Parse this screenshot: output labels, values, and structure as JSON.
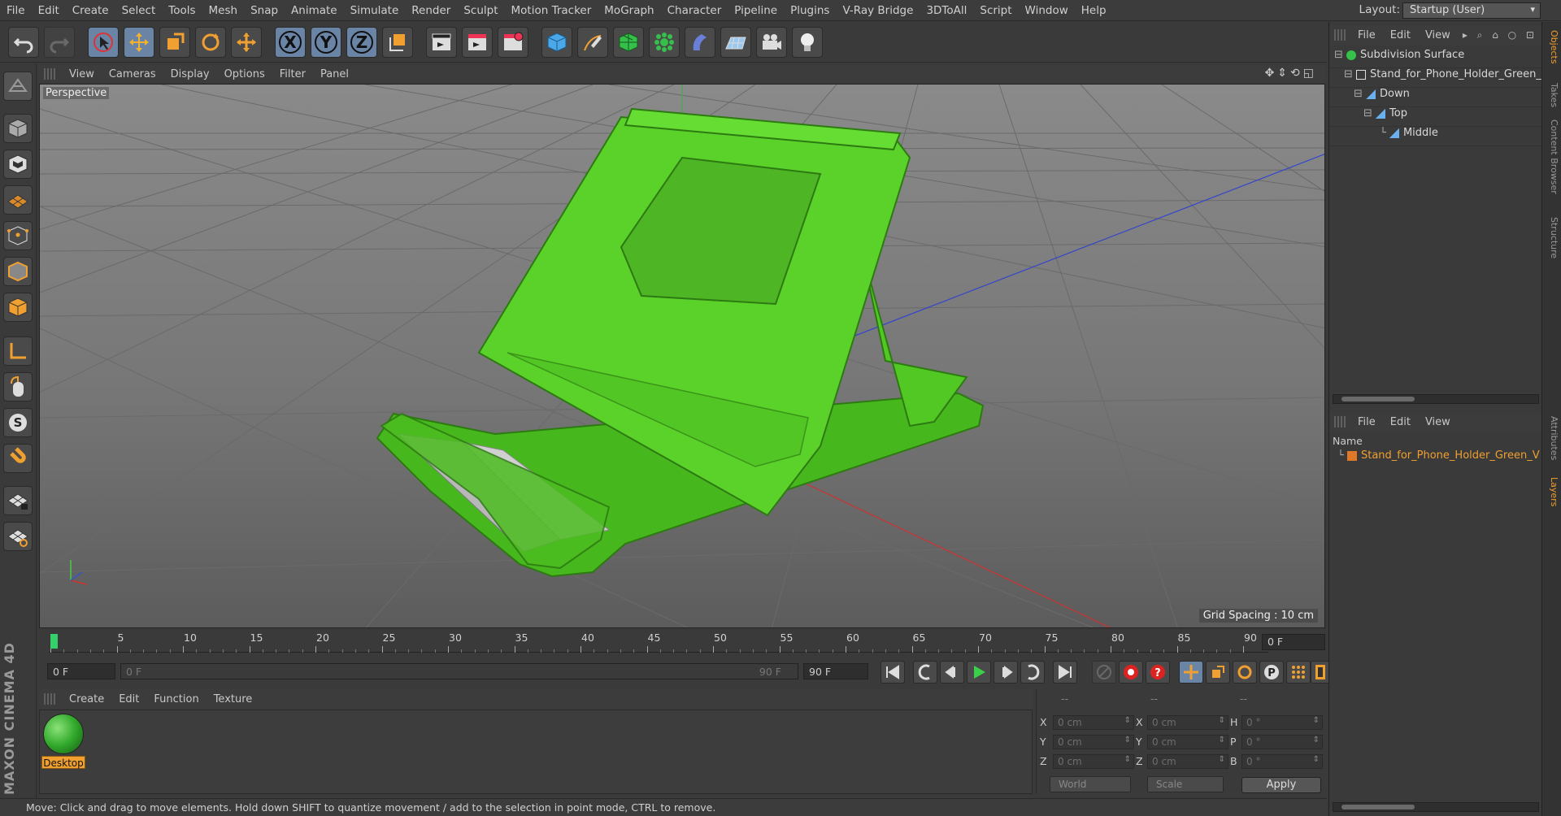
{
  "menu": [
    "File",
    "Edit",
    "Create",
    "Select",
    "Tools",
    "Mesh",
    "Snap",
    "Animate",
    "Simulate",
    "Render",
    "Sculpt",
    "Motion Tracker",
    "MoGraph",
    "Character",
    "Pipeline",
    "Plugins",
    "V-Ray Bridge",
    "3DToAll",
    "Script",
    "Window",
    "Help"
  ],
  "layout": {
    "label": "Layout:",
    "value": "Startup (User)"
  },
  "toolbar": {
    "x_label": "X",
    "y_label": "Y",
    "z_label": "Z"
  },
  "viewport": {
    "menu": [
      "View",
      "Cameras",
      "Display",
      "Options",
      "Filter",
      "Panel"
    ],
    "label": "Perspective",
    "grid_spacing": "Grid Spacing : 10 cm",
    "nav_icons": "✥⇕⟲◱"
  },
  "timeline": {
    "labels": [
      "0",
      "5",
      "10",
      "15",
      "20",
      "25",
      "30",
      "35",
      "40",
      "45",
      "50",
      "55",
      "60",
      "65",
      "70",
      "75",
      "80",
      "85",
      "90"
    ],
    "current_frame_right": "0 F"
  },
  "transport": {
    "current": "0 F",
    "range_start": "0 F",
    "range_end": "90 F",
    "end": "90 F"
  },
  "material_manager": {
    "menu": [
      "Create",
      "Edit",
      "Function",
      "Texture"
    ],
    "material_name": "Desktop"
  },
  "coords": {
    "header": [
      "--",
      "--",
      "--"
    ],
    "rows": [
      {
        "a": "X",
        "av": "0 cm",
        "b": "X",
        "bv": "0 cm",
        "c": "H",
        "cv": "0 °"
      },
      {
        "a": "Y",
        "av": "0 cm",
        "b": "Y",
        "bv": "0 cm",
        "c": "P",
        "cv": "0 °"
      },
      {
        "a": "Z",
        "av": "0 cm",
        "b": "Z",
        "bv": "0 cm",
        "c": "B",
        "cv": "0 °"
      }
    ],
    "world": "World",
    "scale": "Scale",
    "apply": "Apply"
  },
  "status": "Move: Click and drag to move elements. Hold down SHIFT to quantize movement / add to the selection in point mode, CTRL to remove.",
  "objects_panel": {
    "menu": [
      "File",
      "Edit",
      "View"
    ],
    "items": [
      {
        "name": "Subdivision Surface"
      },
      {
        "name": "Stand_for_Phone_Holder_Green_"
      },
      {
        "name": "Down"
      },
      {
        "name": "Top"
      },
      {
        "name": "Middle"
      }
    ]
  },
  "layers_panel": {
    "menu": [
      "File",
      "Edit",
      "View"
    ],
    "column": "Name",
    "items": [
      {
        "name": "Stand_for_Phone_Holder_Green_V"
      }
    ]
  },
  "side_tabs": [
    "Objects",
    "Takes",
    "Content Browser",
    "Structure",
    "Attributes",
    "Layers"
  ],
  "logo": "MAXON CINEMA 4D",
  "colors": {
    "accent_orange": "#f0a030",
    "model_green": "#57d12a",
    "playhead": "#35d06a",
    "selected_tool": "#6a84a6"
  }
}
